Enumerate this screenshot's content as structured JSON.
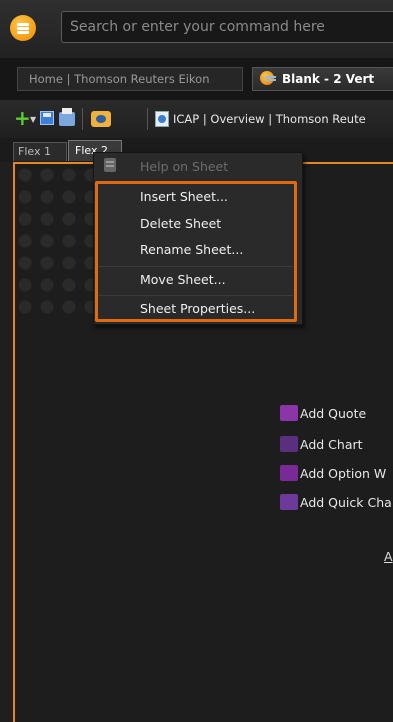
{
  "search": {
    "placeholder": "Search or enter your command here"
  },
  "tabs": [
    {
      "label": "Home | Thomson Reuters Eikon"
    },
    {
      "label": "Blank - 2 Vert"
    }
  ],
  "toolbar": {
    "title": "ICAP | Overview | Thomson Reute"
  },
  "sheet_tabs": [
    {
      "label": "Flex 1"
    },
    {
      "label": "Flex 2"
    }
  ],
  "context_menu": {
    "items": [
      {
        "label": "Help on Sheet",
        "enabled": false
      },
      {
        "label": "Insert Sheet...",
        "enabled": true
      },
      {
        "label": "Delete Sheet",
        "enabled": true
      },
      {
        "label": "Rename Sheet...",
        "enabled": true
      },
      {
        "label": "Move Sheet...",
        "enabled": true
      },
      {
        "label": "Sheet Properties...",
        "enabled": true
      }
    ]
  },
  "workspace": {
    "actions": [
      {
        "label": "Add Quote",
        "icon": "quote-icon"
      },
      {
        "label": "Add Chart",
        "icon": "chart-icon"
      },
      {
        "label": "Add Option W",
        "icon": "option-icon"
      },
      {
        "label": "Add Quick Cha",
        "icon": "quick-chart-icon"
      }
    ],
    "partial_text": "A"
  },
  "colors": {
    "highlight": "#e06a10",
    "accent": "#e8852b"
  }
}
